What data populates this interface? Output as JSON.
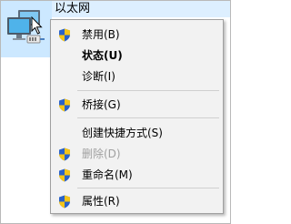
{
  "adapter": {
    "name": "以太网",
    "icon": "network-adapter-icon"
  },
  "context_menu": {
    "items": [
      {
        "id": "disable",
        "label": "禁用(B)",
        "shield": true,
        "bold": false,
        "disabled": false
      },
      {
        "id": "status",
        "label": "状态(U)",
        "shield": false,
        "bold": true,
        "disabled": false
      },
      {
        "id": "diagnose",
        "label": "诊断(I)",
        "shield": false,
        "bold": false,
        "disabled": false
      },
      {
        "id": "bridge",
        "label": "桥接(G)",
        "shield": true,
        "bold": false,
        "disabled": false
      },
      {
        "id": "shortcut",
        "label": "创建快捷方式(S)",
        "shield": false,
        "bold": false,
        "disabled": false
      },
      {
        "id": "delete",
        "label": "删除(D)",
        "shield": true,
        "bold": false,
        "disabled": true
      },
      {
        "id": "rename",
        "label": "重命名(M)",
        "shield": true,
        "bold": false,
        "disabled": false
      },
      {
        "id": "properties",
        "label": "属性(R)",
        "shield": true,
        "bold": false,
        "disabled": false
      }
    ]
  },
  "colors": {
    "selection": "#cce8ff",
    "menu_background": "#f2f2f2",
    "shield_blue": "#2a62c8",
    "shield_yellow": "#f5c518",
    "disabled_text": "#a0a0a0"
  }
}
